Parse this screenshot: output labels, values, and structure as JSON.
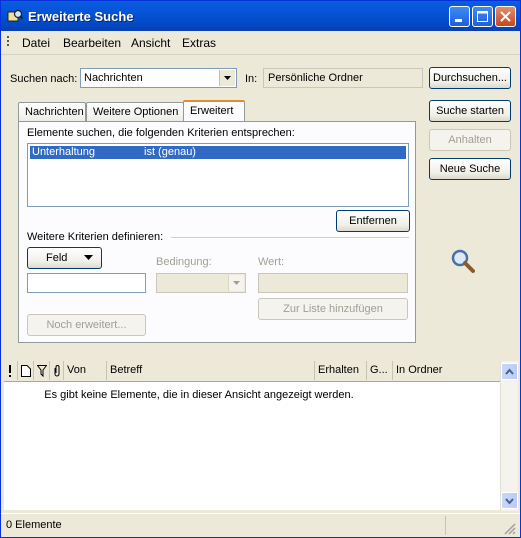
{
  "window": {
    "title": "Erweiterte Suche"
  },
  "menu": [
    {
      "label": "Datei"
    },
    {
      "label": "Bearbeiten"
    },
    {
      "label": "Ansicht"
    },
    {
      "label": "Extras"
    }
  ],
  "search": {
    "look_for_label": "Suchen nach:",
    "look_for_value": "Nachrichten",
    "in_label": "In:",
    "in_value": "Persönliche Ordner",
    "browse_button": "Durchsuchen..."
  },
  "side_buttons": {
    "start": "Suche starten",
    "stop": "Anhalten",
    "new": "Neue Suche"
  },
  "tabs": [
    {
      "label": "Nachrichten"
    },
    {
      "label": "Weitere Optionen"
    },
    {
      "label": "Erweitert"
    }
  ],
  "advanced": {
    "criteria_heading": "Elemente suchen, die folgenden Kriterien entsprechen:",
    "criteria_rows": [
      {
        "field": "Unterhaltung",
        "condition": "ist (genau)"
      }
    ],
    "remove_button": "Entfernen",
    "define_heading": "Weitere Kriterien definieren:",
    "field_button": "Feld",
    "condition_label": "Bedingung:",
    "value_label": "Wert:",
    "add_button": "Zur Liste hinzufügen",
    "more_button": "Noch erweitert..."
  },
  "results": {
    "columns": [
      "Von",
      "Betreff",
      "Erhalten",
      "G...",
      "In Ordner"
    ],
    "empty_message": "Es gibt keine Elemente, die in dieser Ansicht angezeigt werden."
  },
  "status": {
    "text": "0 Elemente"
  },
  "colors": {
    "titlebar": "#0553d6",
    "selection": "#316ac5",
    "tab_highlight": "#e68b2c"
  }
}
